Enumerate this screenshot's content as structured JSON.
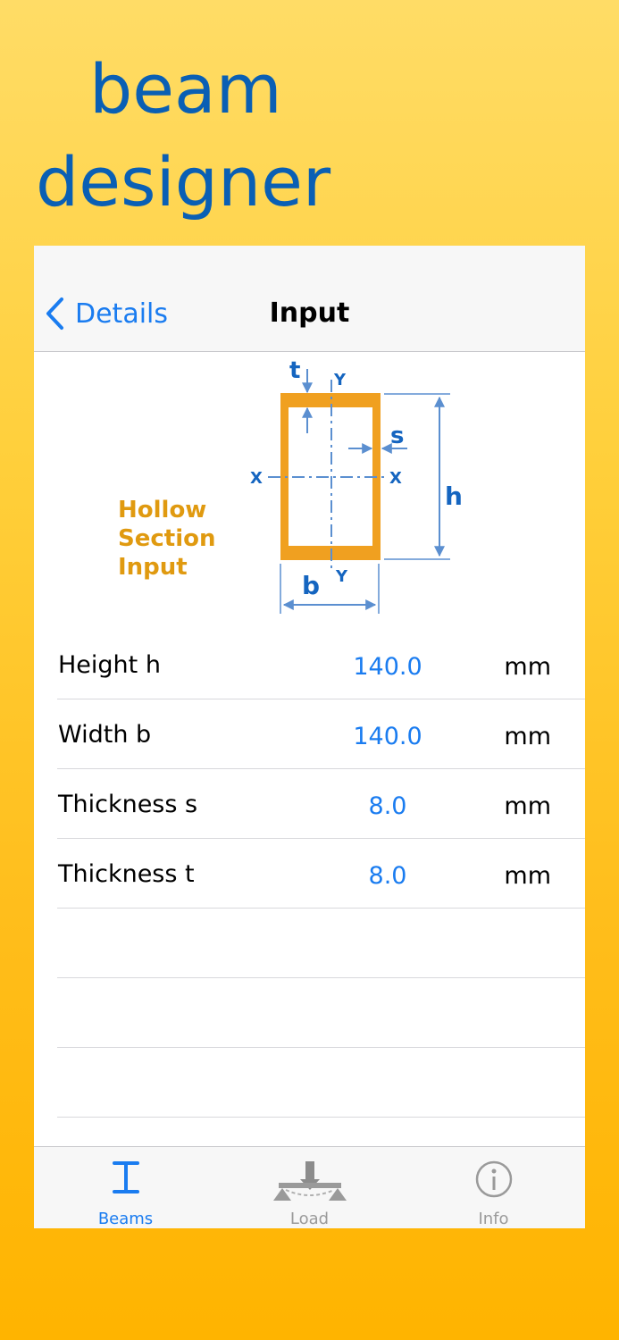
{
  "promo": {
    "line1": "beam",
    "line2": "designer"
  },
  "navbar": {
    "back_label": "Details",
    "title": "Input"
  },
  "diagram": {
    "labels": {
      "t": "t",
      "s": "s",
      "h": "h",
      "b": "b",
      "x": "X",
      "y": "Y"
    },
    "section_label": [
      "Hollow",
      "Section",
      "Input"
    ]
  },
  "inputs": [
    {
      "label": "Height h",
      "value": "140.0",
      "unit": "mm"
    },
    {
      "label": "Width b",
      "value": "140.0",
      "unit": "mm"
    },
    {
      "label": "Thickness s",
      "value": "8.0",
      "unit": "mm"
    },
    {
      "label": "Thickness t",
      "value": "8.0",
      "unit": "mm"
    }
  ],
  "tabs": [
    {
      "label": "Beams",
      "icon": "i-beam-icon",
      "active": true
    },
    {
      "label": "Load",
      "icon": "load-icon",
      "active": false
    },
    {
      "label": "Info",
      "icon": "info-icon",
      "active": false
    }
  ],
  "colors": {
    "accent": "#1a7cf0",
    "diagram_blue": "#1565c0",
    "section_orange": "#f0a020",
    "label_orange": "#e09a10",
    "inactive": "#9a9a9a"
  }
}
